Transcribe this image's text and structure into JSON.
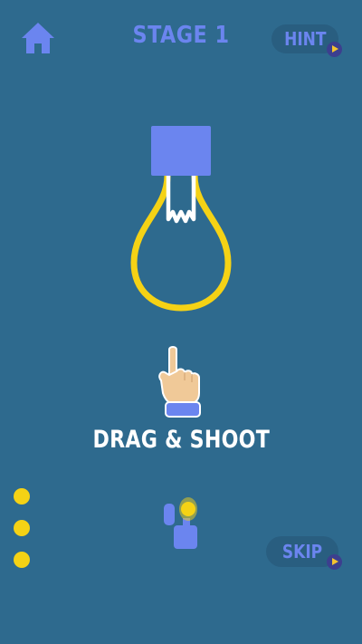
{
  "header": {
    "title": "STAGE 1",
    "hint_label": "HINT"
  },
  "icons": {
    "home": "home-icon",
    "hint_badge": "play-icon",
    "skip_badge": "play-icon",
    "bulb": "lightbulb-icon",
    "hand": "pointing-hand-icon",
    "shooter": "bulb-launcher-icon"
  },
  "main": {
    "instruction": "DRAG & SHOOT"
  },
  "ammo": {
    "remaining": 3
  },
  "footer": {
    "skip_label": "SKIP"
  },
  "colors": {
    "background": "#2e6a8e",
    "accent": "#6b85ef",
    "bulb_glow": "#f5d215",
    "badge": "#3c3f8f"
  }
}
